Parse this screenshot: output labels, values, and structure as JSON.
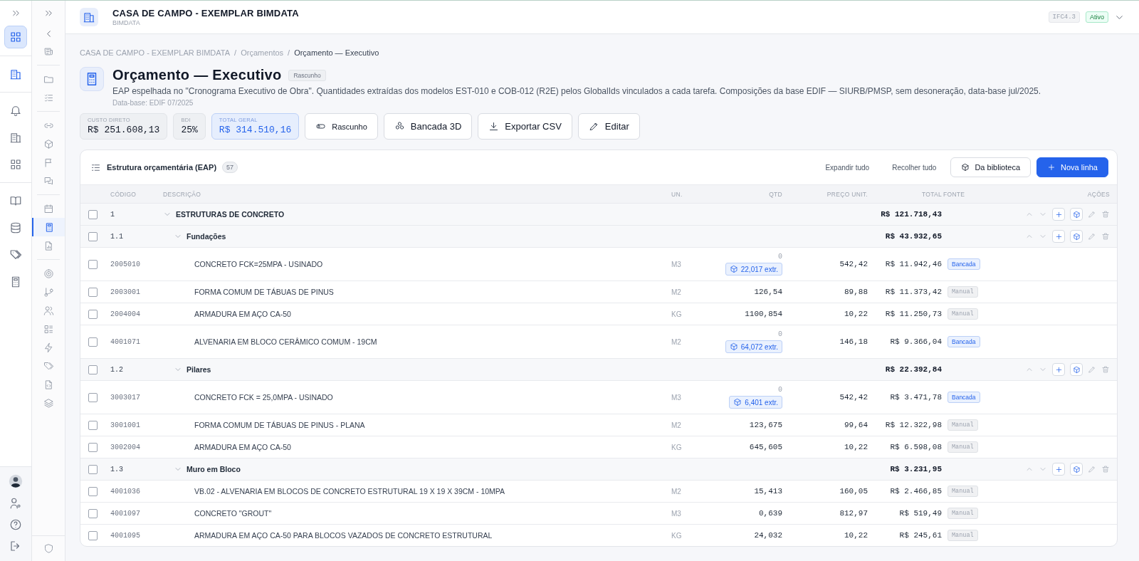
{
  "nav_primary": [
    {
      "selected": true
    },
    {
      "selected": false
    },
    {
      "selected": false
    },
    {
      "selected": false
    },
    {
      "selected": false
    },
    {
      "selected": false
    },
    {
      "selected": false
    },
    {
      "selected": false
    },
    {
      "selected": false
    }
  ],
  "nav_secondary": [
    {
      "selected": false
    },
    {
      "selected": false
    },
    {
      "selected": false
    },
    {
      "selected": false
    },
    {
      "selected": false
    },
    {
      "selected": false
    },
    {
      "selected": false
    },
    {
      "selected": false
    },
    {
      "selected": true
    },
    {
      "selected": false
    },
    {
      "selected": false
    },
    {
      "selected": false
    },
    {
      "selected": false
    },
    {
      "selected": false
    },
    {
      "selected": false
    },
    {
      "selected": false
    },
    {
      "selected": false
    },
    {
      "selected": false
    }
  ],
  "project": {
    "title": "CASA DE CAMPO - EXEMPLAR BIMDATA",
    "subtitle": "BIMDATA",
    "format": "IFC4.3",
    "status": "Ativo"
  },
  "breadcrumb": {
    "separator": "/",
    "items": [
      "CASA DE CAMPO - EXEMPLAR BIMDATA",
      "Orçamentos",
      "Orçamento — Executivo"
    ]
  },
  "budget": {
    "title": "Orçamento — Executivo",
    "status": "Rascunho",
    "description": "EAP espelhada no \"Cronograma Executivo de Obra\". Quantidades extraídas dos modelos EST-010 e COB-012 (R2E) pelos GlobalIds vinculados a cada tarefa. Composições da base EDIF — SIURB/PMSP, sem desoneração, data-base jul/2025.",
    "database": "Data-base: EDIF 07/2025"
  },
  "stats": [
    {
      "label": "CUSTO DIRETO",
      "value": "R$ 251.608,13",
      "highlight": false
    },
    {
      "label": "BDI",
      "value": "25%",
      "highlight": false
    },
    {
      "label": "TOTAL GERAL",
      "value": "R$ 314.510,16",
      "highlight": true
    }
  ],
  "actions": [
    "Rascunho",
    "Bancada 3D",
    "Exportar CSV",
    "Editar"
  ],
  "table": {
    "title": "Estrutura orçamentária (EAP)",
    "count": "57",
    "expand_all": "Expandir tudo",
    "collapse_all": "Recolher tudo",
    "library": "Da biblioteca",
    "new_line": "Nova linha",
    "columns": [
      "CÓDIGO",
      "DESCRIÇÃO",
      "UN.",
      "QTD",
      "PREÇO UNIT.",
      "TOTAL",
      "FONTE",
      "AÇÕES"
    ],
    "rows": [
      {
        "kind": "group",
        "checked": false,
        "expanded": true,
        "code": "1",
        "name": "ESTRUTURAS DE CONCRETO",
        "total": "R$ 121.718,43",
        "children": [
          {
            "kind": "group",
            "checked": false,
            "expanded": true,
            "code": "1.1",
            "name": "Fundações",
            "total": "R$ 43.932,65",
            "children": [
              {
                "kind": "item",
                "checked": false,
                "code": "2005010",
                "name": "CONCRETO FCK=25MPA - USINADO",
                "unit": "M3",
                "quantity": "0",
                "extracted": "22,017 extr.",
                "price": "542,42",
                "total": "R$ 11.942,46",
                "source": {
                  "label": "Bancada",
                  "kind": "model"
                }
              },
              {
                "kind": "item",
                "checked": false,
                "code": "2003001",
                "name": "FORMA COMUM DE TÁBUAS DE PINUS",
                "unit": "M2",
                "quantity": "126,54",
                "price": "89,88",
                "total": "R$ 11.373,42",
                "source": {
                  "label": "Manual",
                  "kind": "manual"
                }
              },
              {
                "kind": "item",
                "checked": false,
                "code": "2004004",
                "name": "ARMADURA EM AÇO CA-50",
                "unit": "KG",
                "quantity": "1100,854",
                "price": "10,22",
                "total": "R$ 11.250,73",
                "source": {
                  "label": "Manual",
                  "kind": "manual"
                }
              },
              {
                "kind": "item",
                "checked": false,
                "code": "4001071",
                "name": "ALVENARIA EM BLOCO CERÂMICO COMUM - 19CM",
                "unit": "M2",
                "quantity": "0",
                "extracted": "64,072 extr.",
                "price": "146,18",
                "total": "R$ 9.366,04",
                "source": {
                  "label": "Bancada",
                  "kind": "model"
                }
              }
            ]
          },
          {
            "kind": "group",
            "checked": false,
            "expanded": true,
            "code": "1.2",
            "name": "Pilares",
            "total": "R$ 22.392,84",
            "children": [
              {
                "kind": "item",
                "checked": false,
                "code": "3003017",
                "name": "CONCRETO FCK = 25,0MPA - USINADO",
                "unit": "M3",
                "quantity": "0",
                "extracted": "6,401 extr.",
                "price": "542,42",
                "total": "R$ 3.471,78",
                "source": {
                  "label": "Bancada",
                  "kind": "model"
                }
              },
              {
                "kind": "item",
                "checked": false,
                "code": "3001001",
                "name": "FORMA COMUM DE TÁBUAS DE PINUS - PLANA",
                "unit": "M2",
                "quantity": "123,675",
                "price": "99,64",
                "total": "R$ 12.322,98",
                "source": {
                  "label": "Manual",
                  "kind": "manual"
                }
              },
              {
                "kind": "item",
                "checked": false,
                "code": "3002004",
                "name": "ARMADURA EM AÇO CA-50",
                "unit": "KG",
                "quantity": "645,605",
                "price": "10,22",
                "total": "R$ 6.598,08",
                "source": {
                  "label": "Manual",
                  "kind": "manual"
                }
              }
            ]
          },
          {
            "kind": "group",
            "checked": false,
            "expanded": true,
            "code": "1.3",
            "name": "Muro em Bloco",
            "total": "R$ 3.231,95",
            "children": [
              {
                "kind": "item",
                "checked": false,
                "code": "4001036",
                "name": "VB.02 - ALVENARIA EM BLOCOS DE CONCRETO ESTRUTURAL 19 X 19 X 39CM - 10MPA",
                "unit": "M2",
                "quantity": "15,413",
                "price": "160,05",
                "total": "R$ 2.466,85",
                "source": {
                  "label": "Manual",
                  "kind": "manual"
                }
              },
              {
                "kind": "item",
                "checked": false,
                "code": "4001097",
                "name": "CONCRETO \"GROUT\"",
                "unit": "M3",
                "quantity": "0,639",
                "price": "812,97",
                "total": "R$ 519,49",
                "source": {
                  "label": "Manual",
                  "kind": "manual"
                }
              },
              {
                "kind": "item",
                "checked": false,
                "code": "4001095",
                "name": "ARMADURA EM AÇO CA-50 PARA BLOCOS VAZADOS DE CONCRETO ESTRUTURAL",
                "unit": "KG",
                "quantity": "24,032",
                "price": "10,22",
                "total": "R$ 245,61",
                "source": {
                  "label": "Manual",
                  "kind": "manual"
                }
              }
            ]
          }
        ]
      }
    ]
  }
}
